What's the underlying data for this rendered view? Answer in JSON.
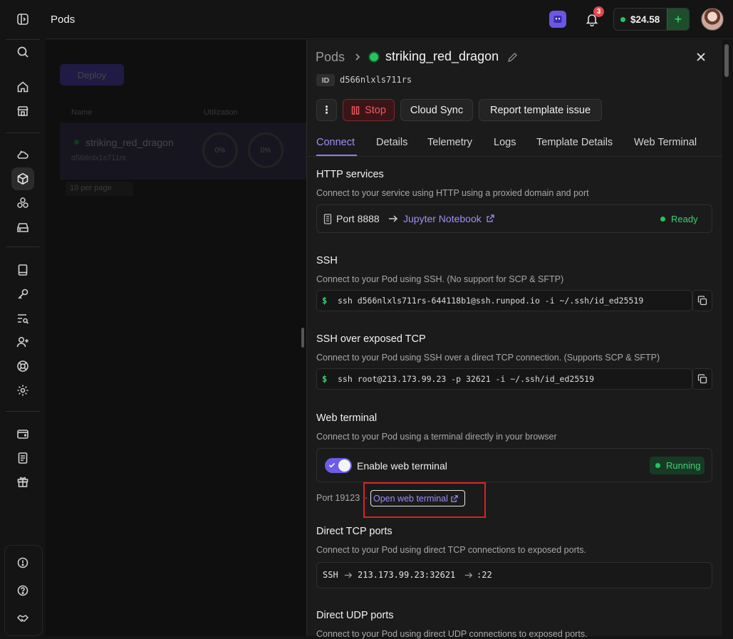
{
  "topbar": {
    "title": "Pods",
    "notifications_count": "3",
    "balance": "$24.58",
    "add_label": "+"
  },
  "background": {
    "deploy_label": "Deploy",
    "columns": [
      "Name",
      "Utilization"
    ],
    "row_name": "striking_red_dragon",
    "row_sub": "d566nlx1s711rs",
    "util_1": "0%",
    "util_2": "0%",
    "per_page": "10 per page"
  },
  "panel": {
    "breadcrumb": "Pods",
    "pod_name": "striking_red_dragon",
    "id_label": "ID",
    "pod_id": "d566nlxls711rs",
    "buttons": {
      "more": "⋮",
      "stop": "Stop",
      "cloud_sync": "Cloud Sync",
      "report": "Report template issue"
    },
    "tabs": [
      "Connect",
      "Details",
      "Telemetry",
      "Logs",
      "Template Details",
      "Web Terminal"
    ],
    "http": {
      "title": "HTTP services",
      "desc": "Connect to your service using HTTP using a proxied domain and port",
      "port": "Port 8888",
      "service": "Jupyter Notebook",
      "status": "Ready"
    },
    "ssh": {
      "title": "SSH",
      "desc": "Connect to your Pod using SSH. (No support for SCP & SFTP)",
      "prompt": "$",
      "command": "ssh d566nlxls711rs-644118b1@ssh.runpod.io -i ~/.ssh/id_ed25519"
    },
    "ssh_tcp": {
      "title": "SSH over exposed TCP",
      "desc": "Connect to your Pod using SSH over a direct TCP connection. (Supports SCP & SFTP)",
      "prompt": "$",
      "command": "ssh root@213.173.99.23 -p 32621 -i ~/.ssh/id_ed25519"
    },
    "web_terminal": {
      "title": "Web terminal",
      "desc": "Connect to your Pod using a terminal directly in your browser",
      "toggle_label": "Enable web terminal",
      "status": "Running",
      "port": "Port 19123",
      "separator": "·",
      "link": "Open web terminal"
    },
    "tcp_ports": {
      "title": "Direct TCP ports",
      "desc": "Connect to your Pod using direct TCP connections to exposed ports.",
      "protocol": "SSH",
      "address": "213.173.99.23:32621",
      "internal": ":22"
    },
    "udp_ports": {
      "title": "Direct UDP ports",
      "desc": "Connect to your Pod using direct UDP connections to exposed ports."
    }
  },
  "colors": {
    "accent": "#8b7cf6",
    "toggle": "#6d5ce8",
    "status_green": "#22c55e",
    "stop_red": "#e5484d",
    "highlight_box": "#e02020"
  }
}
